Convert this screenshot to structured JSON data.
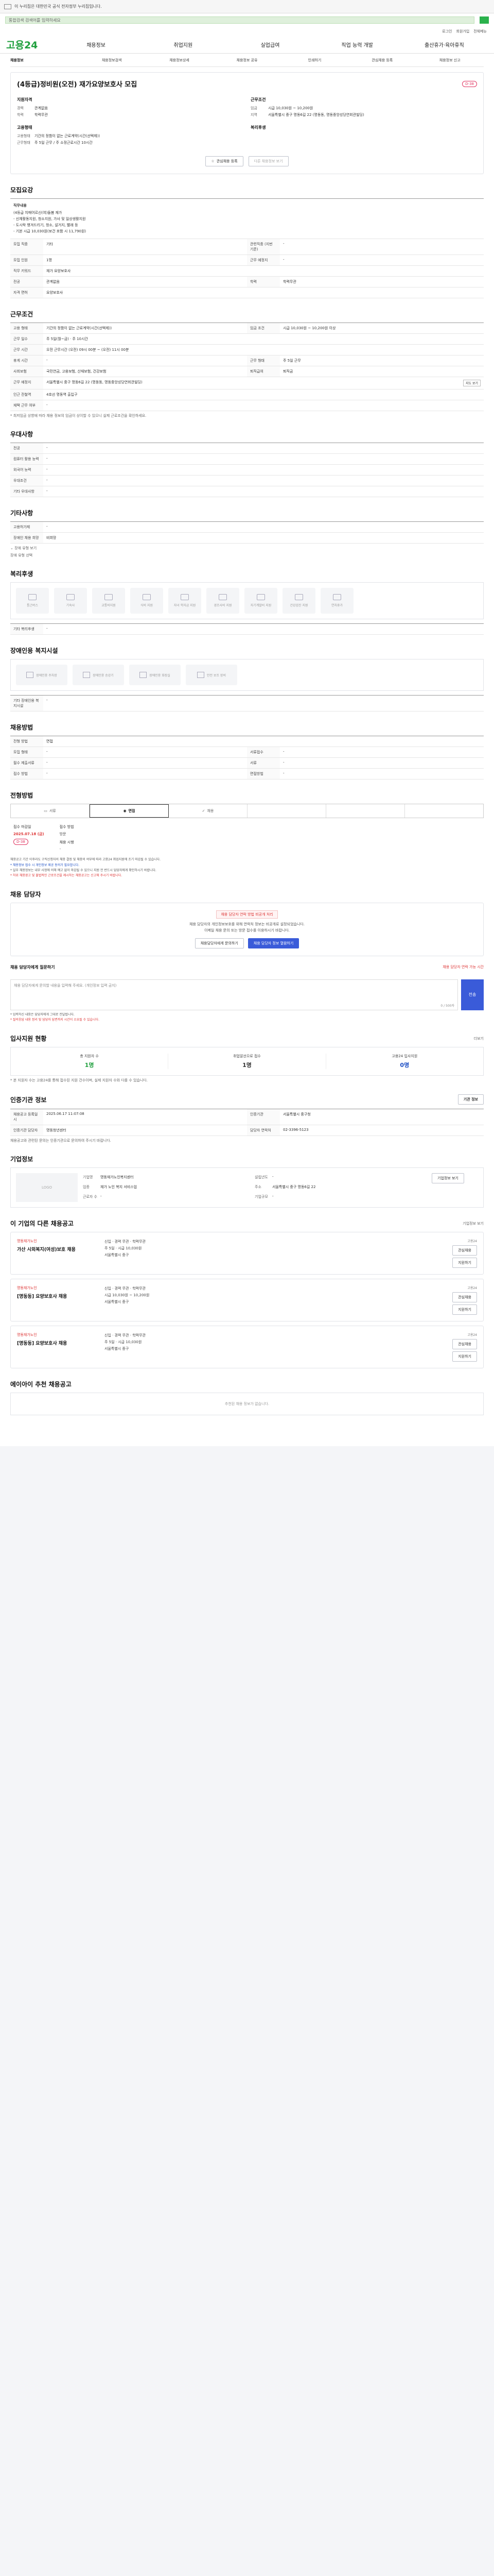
{
  "topbar": {
    "text": "이 누리집은 대한민국 공식 전자정부 누리집입니다."
  },
  "search": {
    "placeholder": "통합검색 검색어를 입력하세요"
  },
  "util": [
    "로그인",
    "회원가입",
    "전체메뉴"
  ],
  "logo": {
    "brand": "고용24"
  },
  "gnb": [
    "채용정보",
    "취업지원",
    "실업급여",
    "직업 능력 개발",
    "출산휴가·육아휴직"
  ],
  "crumb": [
    "채용정보",
    "채용정보검색",
    "채용정보상세",
    "채용정보 공유",
    "인쇄하기",
    "관심채용 등록",
    "채용정보 신고"
  ],
  "job": {
    "title": "(4등급)정비원(오전) 재가요양보호사 모집",
    "dday": "D-38",
    "qual_head": "지원자격",
    "qual": [
      {
        "k": "경력",
        "v": "관계없음"
      },
      {
        "k": "학력",
        "v": "학력무관"
      }
    ],
    "cond_head": "근무조건",
    "cond": [
      {
        "k": "임금",
        "v": "시급 10,030원 ~ 10,200원"
      },
      {
        "k": "지역",
        "v": "서울특별시 중구 명동6길 22 (명동동, 명동중앙성당연회관빌딩)"
      }
    ],
    "kind_head": "고용형태",
    "kind": [
      {
        "k": "고용형태",
        "v": "기간의 정함이 없는 근로계약(시간(선택제))"
      },
      {
        "k": "근무형태",
        "v": "주 5일 근무 / 주 소정근로시간 10시간"
      }
    ],
    "welfare_head": "복리후생",
    "btn_apply": "관심채용 등록",
    "btn_share": "다른 채용정보 보기"
  },
  "recruit": {
    "title": "모집요강",
    "desc_label": "직무내용",
    "desc_lines": [
      "(4등급 치매어르신(여)돌봄 재가",
      "- 신체활동지원, 청소지원, 가사 및 일상생활지원",
      "- 도시락 챙겨드리기, 청소, 설거지, 빨래 등",
      "- 기본 시급 10,030원(보건 포함 시 11,790원)"
    ],
    "rows": [
      {
        "k": "모집 직종",
        "v": "기타",
        "k2": "관련직종 (지번 기준)",
        "v2": "-"
      },
      {
        "k": "모집 인원",
        "v": "1명",
        "k2": "근무 예정지",
        "v2": "-"
      },
      {
        "k": "직무 키워드",
        "v": "재가 요양보호사"
      },
      {
        "k": "전공",
        "v": "관계없음",
        "k2": "학력",
        "v2": "학력무관"
      },
      {
        "k": "자격 면허",
        "v": "요양보호사"
      }
    ]
  },
  "work": {
    "title": "근무조건",
    "rows": [
      {
        "k": "고용 형태",
        "v": "기간의 정함이 없는 근로계약(시간(선택제))",
        "k2": "임금 조건",
        "v2": "시급 10,030원 ~ 10,200원 이상"
      },
      {
        "k": "근무 일수",
        "v": "주 5일(월~금) · 주 10시간"
      },
      {
        "k": "근무 시간",
        "v": "오전 근무시간 (오전) 09시 00분 ~ (오전) 11시 00분",
        "k2": "",
        "v2": ""
      },
      {
        "k": "휴게 시간",
        "v": "-",
        "k2": "근무 형태",
        "v2": "주 5일 근무"
      },
      {
        "k": "사회보험",
        "v": "국민연금, 고용보험, 산재보험, 건강보험",
        "k2": "퇴직급여",
        "v2": "퇴직금"
      },
      {
        "k": "근무 예정지",
        "v": "서울특별시 중구 명동6길 22 (명동동, 명동중앙성당연회관빌딩)",
        "k2": "",
        "v2": "지도 보기"
      },
      {
        "k": "인근 전철역",
        "v": "4호선 명동역 출입구"
      },
      {
        "k": "재택 근무 여부",
        "v": "-"
      }
    ],
    "note": "* 최저임금 상향에 따라 채용 정보의 임금이 상이할 수 있으니 실제 근로조건을 확인하세요.",
    "map_btn": "지도 보기"
  },
  "pref": {
    "title": "우대사항",
    "rows": [
      {
        "k": "전공",
        "v": "-"
      },
      {
        "k": "컴퓨터 활용 능력",
        "v": "-"
      },
      {
        "k": "외국어 능력",
        "v": "-"
      },
      {
        "k": "우대조건",
        "v": "-"
      },
      {
        "k": "기타 우대사항",
        "v": "-"
      }
    ]
  },
  "extra": {
    "title": "기타사항",
    "rows": [
      {
        "k": "고용허가제",
        "v": "-"
      },
      {
        "k": "장애인 채용 희망",
        "v": "비희망"
      }
    ],
    "toggle": "장애 유형 보기",
    "toggle2": "장애 유형 선택"
  },
  "welfare": {
    "title": "복리후생",
    "items": [
      "통근버스",
      "기숙사",
      "교통비지원",
      "식비 지원",
      "자녀 학자금 지원",
      "경조사비 지원",
      "자기계발비 지원",
      "건강검진 지원",
      "연차휴가"
    ],
    "other_label": "기타 복리후생",
    "other_value": "-"
  },
  "facility": {
    "title": "장애인용 복지시설",
    "items": [
      "장애인용 주차장",
      "장애인용 승강기",
      "장애인용 화장실",
      "안전 보조 장비"
    ],
    "other_label": "기타 장애인용 복지시설",
    "other_value": "-"
  },
  "method": {
    "title": "채용방법",
    "rows": [
      {
        "k": "전형 방법",
        "v": "면접"
      },
      {
        "k": "모집 형태",
        "v": "-",
        "k2": "서류접수",
        "v2": "-"
      },
      {
        "k": "필수 제출서류",
        "v": "-",
        "k2": "서류",
        "v2": "-"
      },
      {
        "k": "접수 방법",
        "v": "-",
        "k2": "면접방법",
        "v2": "-"
      }
    ]
  },
  "process": {
    "title": "전형방법",
    "steps": [
      "서류",
      "면접",
      "채용",
      "",
      "",
      ""
    ]
  },
  "deadline": {
    "k1": "접수 마감일",
    "v1": "2025.07.18 (금)",
    "badge": "D-38",
    "k2": "접수 방법",
    "v2": "방문",
    "k3": "채용 시행",
    "v3": "-",
    "notes": [
      {
        "t": "채용공고 기간 이후라도 구직신청자의 채용 결정 및 채용의 여부에 따라 고용24 취업지원에 조기 마감될 수 있습니다.",
        "c": ""
      },
      {
        "t": "* 채용정보 접수 시 개인정보 제공 동의가 필요합니다.",
        "c": "blue"
      },
      {
        "t": "* 일부 채용정보는 내부 사정에 의해 예고 없이 마감될 수 있으니 지원 전 반드시 담당자에게 확인하시기 바랍니다.",
        "c": ""
      },
      {
        "t": "* 허위 채용광고 및 불법적인 근로조건을 제시하는 채용공고는 신고해 주시기 바랍니다.",
        "c": "red"
      }
    ]
  },
  "contact": {
    "title": "채용 담당자",
    "alert": "채용 담당자 연락 방법 비공개 처리",
    "desc": [
      "채용 담당자의 개인정보보호를 위해 연락처 정보는 비공개로 설정되었습니다.",
      "이메일 채용 문의 또는 방문 접수를 이용하시기 바랍니다."
    ],
    "btn1": "채용담당자에게 문의하기",
    "btn2": "채용 담당자 정보 열람하기",
    "q_title": "채용 담당자에게 질문하기",
    "q_link": "채용 담당자 연락 가능 시간",
    "q_placeholder": "채용 담당자에게 문의할 내용을 입력해 주세요. (개인정보 입력 금지)",
    "q_count": "0 / 500자",
    "q_send": "전송",
    "q_notes": [
      "* 입력하신 내용은 담당자에게 그대로 전달됩니다.",
      "* 질의응답 내용 정리 및 담당자 답변까지 시간이 소요될 수 있습니다."
    ]
  },
  "applicants": {
    "title": "입사지원 현황",
    "link": "더보기",
    "items": [
      {
        "l": "총 지원자 수",
        "v": "1명",
        "c": "green"
      },
      {
        "l": "취업알선으로 접수",
        "v": "1명",
        "c": ""
      },
      {
        "l": "고용24 입사지원",
        "v": "0명",
        "c": "blue"
      }
    ],
    "note": "* 본 지원자 수는 고용24를 통해 접수된 지원 건수이며, 실제 지원자 수와 다를 수 있습니다."
  },
  "info": {
    "title": "인증기관 정보",
    "btn": "기관 정보",
    "rows": [
      {
        "k": "채용공고 등록일시",
        "v": "2025.06.17 11:07:08",
        "k2": "인증기관",
        "v2": "서울특별시 중구청"
      },
      {
        "k": "인증기관 담당자",
        "v": "명동청년센터",
        "k2": "담당자 연락처",
        "v2": "02-3396-5123"
      }
    ],
    "note": "채용공고와 관련된 문의는 인증기관으로 문의하여 주시기 바랍니다."
  },
  "company": {
    "title": "기업정보",
    "logo": "LOGO",
    "rows": [
      {
        "k": "기업명",
        "v": "명동재가노인복지센터"
      },
      {
        "k": "업종",
        "v": "재가 노인 복지 서비스업"
      },
      {
        "k": "근로자 수",
        "v": "-"
      },
      {
        "k": "설립년도",
        "v": "-"
      },
      {
        "k": "주소",
        "v": "서울특별시 중구 명동6길 22"
      },
      {
        "k": "기업규모",
        "v": "-"
      }
    ],
    "btn": "기업정보 보기"
  },
  "similar": {
    "title": "이 기업의 다른 채용공고",
    "link": "기업정보 보기",
    "items": [
      {
        "co": "명동재가노인",
        "title": "가산 시외복지(여성)보호 채용",
        "lines": [
          "신입 · 경력 무관 · 학력무관",
          "주 5일 · 시급 10,030원",
          "서울특별시 중구"
        ],
        "gov": "고용24",
        "b1": "관심채용",
        "b2": "지원하기"
      },
      {
        "co": "명동재가노인",
        "title": "[명동동] 요양보호사 채용",
        "lines": [
          "신입 · 경력 무관 · 학력무관",
          "시급 10,030원 ~ 10,200원",
          "서울특별시 중구"
        ],
        "gov": "고용24",
        "b1": "관심채용",
        "b2": "지원하기"
      },
      {
        "co": "명동재가노인",
        "title": "[명동동] 요양보호사 채용",
        "lines": [
          "신입 · 경력 무관 · 학력무관",
          "주 5일 · 시급 10,030원",
          "서울특별시 중구"
        ],
        "gov": "고용24",
        "b1": "관심채용",
        "b2": "지원하기"
      }
    ]
  },
  "recommend": {
    "title": "에이아이 추천 채용공고",
    "empty": "추천된 채용 정보가 없습니다."
  }
}
